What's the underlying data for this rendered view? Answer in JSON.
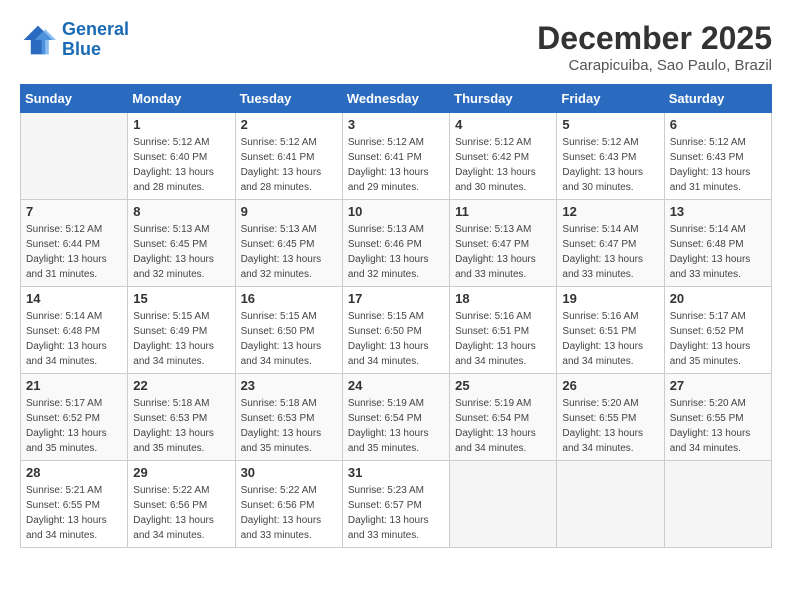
{
  "logo": {
    "line1": "General",
    "line2": "Blue"
  },
  "title": "December 2025",
  "subtitle": "Carapicuiba, Sao Paulo, Brazil",
  "weekdays": [
    "Sunday",
    "Monday",
    "Tuesday",
    "Wednesday",
    "Thursday",
    "Friday",
    "Saturday"
  ],
  "weeks": [
    [
      {
        "day": "",
        "info": ""
      },
      {
        "day": "1",
        "info": "Sunrise: 5:12 AM\nSunset: 6:40 PM\nDaylight: 13 hours\nand 28 minutes."
      },
      {
        "day": "2",
        "info": "Sunrise: 5:12 AM\nSunset: 6:41 PM\nDaylight: 13 hours\nand 28 minutes."
      },
      {
        "day": "3",
        "info": "Sunrise: 5:12 AM\nSunset: 6:41 PM\nDaylight: 13 hours\nand 29 minutes."
      },
      {
        "day": "4",
        "info": "Sunrise: 5:12 AM\nSunset: 6:42 PM\nDaylight: 13 hours\nand 30 minutes."
      },
      {
        "day": "5",
        "info": "Sunrise: 5:12 AM\nSunset: 6:43 PM\nDaylight: 13 hours\nand 30 minutes."
      },
      {
        "day": "6",
        "info": "Sunrise: 5:12 AM\nSunset: 6:43 PM\nDaylight: 13 hours\nand 31 minutes."
      }
    ],
    [
      {
        "day": "7",
        "info": "Sunrise: 5:12 AM\nSunset: 6:44 PM\nDaylight: 13 hours\nand 31 minutes."
      },
      {
        "day": "8",
        "info": "Sunrise: 5:13 AM\nSunset: 6:45 PM\nDaylight: 13 hours\nand 32 minutes."
      },
      {
        "day": "9",
        "info": "Sunrise: 5:13 AM\nSunset: 6:45 PM\nDaylight: 13 hours\nand 32 minutes."
      },
      {
        "day": "10",
        "info": "Sunrise: 5:13 AM\nSunset: 6:46 PM\nDaylight: 13 hours\nand 32 minutes."
      },
      {
        "day": "11",
        "info": "Sunrise: 5:13 AM\nSunset: 6:47 PM\nDaylight: 13 hours\nand 33 minutes."
      },
      {
        "day": "12",
        "info": "Sunrise: 5:14 AM\nSunset: 6:47 PM\nDaylight: 13 hours\nand 33 minutes."
      },
      {
        "day": "13",
        "info": "Sunrise: 5:14 AM\nSunset: 6:48 PM\nDaylight: 13 hours\nand 33 minutes."
      }
    ],
    [
      {
        "day": "14",
        "info": "Sunrise: 5:14 AM\nSunset: 6:48 PM\nDaylight: 13 hours\nand 34 minutes."
      },
      {
        "day": "15",
        "info": "Sunrise: 5:15 AM\nSunset: 6:49 PM\nDaylight: 13 hours\nand 34 minutes."
      },
      {
        "day": "16",
        "info": "Sunrise: 5:15 AM\nSunset: 6:50 PM\nDaylight: 13 hours\nand 34 minutes."
      },
      {
        "day": "17",
        "info": "Sunrise: 5:15 AM\nSunset: 6:50 PM\nDaylight: 13 hours\nand 34 minutes."
      },
      {
        "day": "18",
        "info": "Sunrise: 5:16 AM\nSunset: 6:51 PM\nDaylight: 13 hours\nand 34 minutes."
      },
      {
        "day": "19",
        "info": "Sunrise: 5:16 AM\nSunset: 6:51 PM\nDaylight: 13 hours\nand 34 minutes."
      },
      {
        "day": "20",
        "info": "Sunrise: 5:17 AM\nSunset: 6:52 PM\nDaylight: 13 hours\nand 35 minutes."
      }
    ],
    [
      {
        "day": "21",
        "info": "Sunrise: 5:17 AM\nSunset: 6:52 PM\nDaylight: 13 hours\nand 35 minutes."
      },
      {
        "day": "22",
        "info": "Sunrise: 5:18 AM\nSunset: 6:53 PM\nDaylight: 13 hours\nand 35 minutes."
      },
      {
        "day": "23",
        "info": "Sunrise: 5:18 AM\nSunset: 6:53 PM\nDaylight: 13 hours\nand 35 minutes."
      },
      {
        "day": "24",
        "info": "Sunrise: 5:19 AM\nSunset: 6:54 PM\nDaylight: 13 hours\nand 35 minutes."
      },
      {
        "day": "25",
        "info": "Sunrise: 5:19 AM\nSunset: 6:54 PM\nDaylight: 13 hours\nand 34 minutes."
      },
      {
        "day": "26",
        "info": "Sunrise: 5:20 AM\nSunset: 6:55 PM\nDaylight: 13 hours\nand 34 minutes."
      },
      {
        "day": "27",
        "info": "Sunrise: 5:20 AM\nSunset: 6:55 PM\nDaylight: 13 hours\nand 34 minutes."
      }
    ],
    [
      {
        "day": "28",
        "info": "Sunrise: 5:21 AM\nSunset: 6:55 PM\nDaylight: 13 hours\nand 34 minutes."
      },
      {
        "day": "29",
        "info": "Sunrise: 5:22 AM\nSunset: 6:56 PM\nDaylight: 13 hours\nand 34 minutes."
      },
      {
        "day": "30",
        "info": "Sunrise: 5:22 AM\nSunset: 6:56 PM\nDaylight: 13 hours\nand 33 minutes."
      },
      {
        "day": "31",
        "info": "Sunrise: 5:23 AM\nSunset: 6:57 PM\nDaylight: 13 hours\nand 33 minutes."
      },
      {
        "day": "",
        "info": ""
      },
      {
        "day": "",
        "info": ""
      },
      {
        "day": "",
        "info": ""
      }
    ]
  ]
}
